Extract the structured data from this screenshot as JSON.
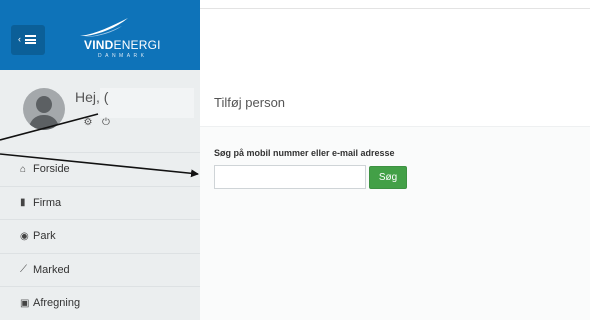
{
  "brand": {
    "logo_bold": "VIND",
    "logo_regular": "ENERGI",
    "logo_sub": "DANMARK",
    "color": "#0e73b9"
  },
  "user_panel": {
    "greeting": "Hej, (",
    "icons": [
      "gear-icon",
      "power-icon"
    ]
  },
  "sidebar": {
    "items": [
      {
        "icon": "home-icon",
        "label": "Forside"
      },
      {
        "icon": "building-icon",
        "label": "Firma"
      },
      {
        "icon": "dashboard-icon",
        "label": "Park"
      },
      {
        "icon": "line-chart-icon",
        "label": "Marked"
      },
      {
        "icon": "money-icon",
        "label": "Afregning"
      }
    ]
  },
  "main": {
    "box_title": "Tilføj person",
    "search_label": "Søg på mobil nummer eller e-mail adresse",
    "search_value": "",
    "search_placeholder": "",
    "search_button": "Søg",
    "button_color": "#43a047"
  }
}
